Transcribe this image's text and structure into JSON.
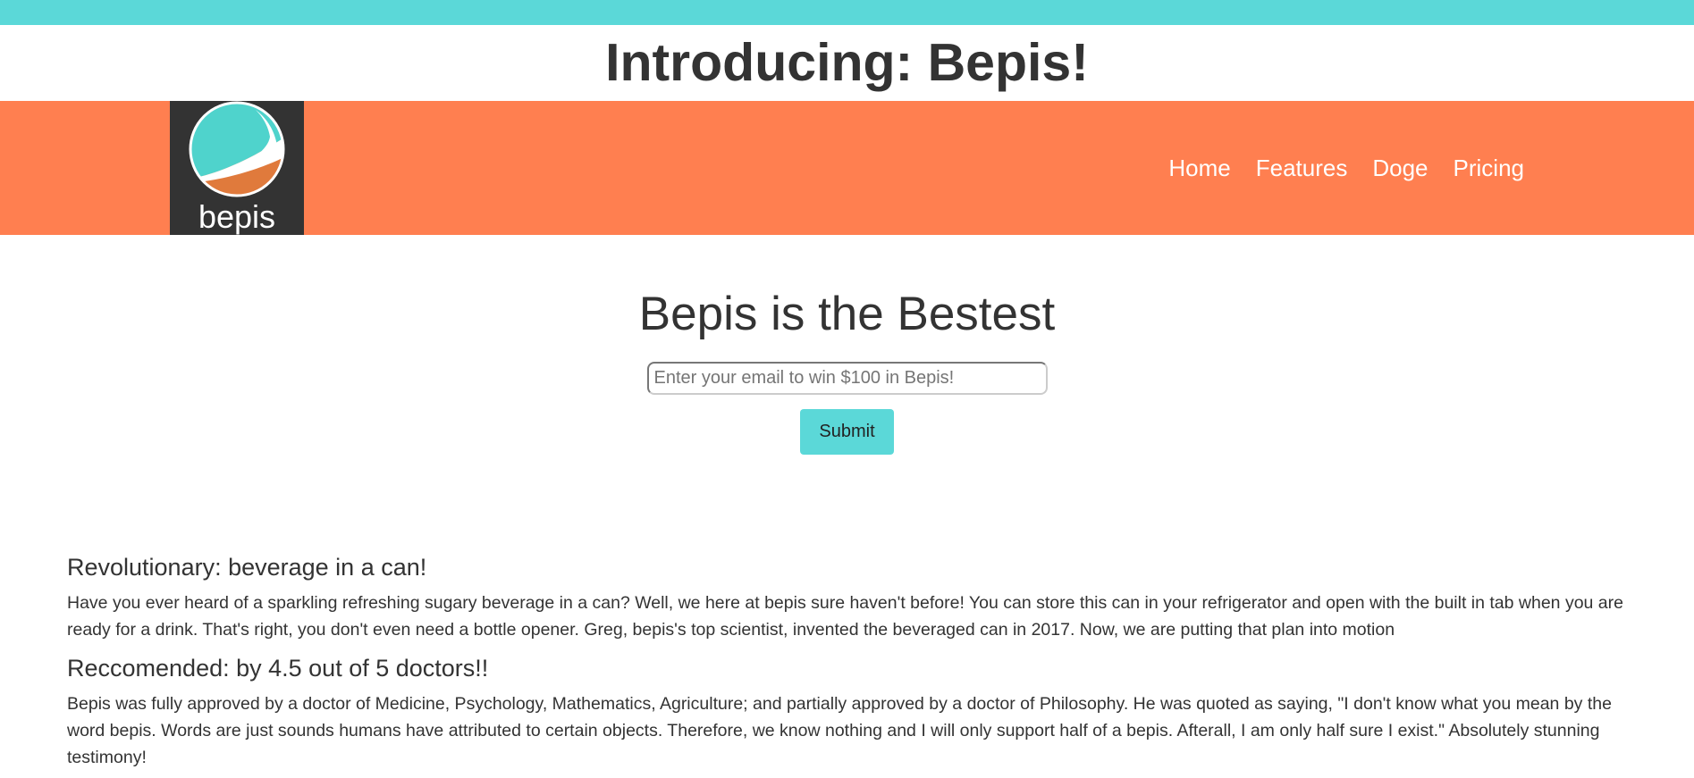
{
  "page": {
    "title": "Introducing: Bepis!"
  },
  "colors": {
    "top_strip": "#5bd8d8",
    "navbar": "#ff7f50",
    "logo_bg": "#333333",
    "button": "#5bd8d8"
  },
  "logo": {
    "text": "bepis",
    "icon": "bepis-logo-icon"
  },
  "nav": {
    "items": [
      {
        "label": "Home"
      },
      {
        "label": "Features"
      },
      {
        "label": "Doge"
      },
      {
        "label": "Pricing"
      }
    ]
  },
  "hero": {
    "title": "Bepis is the Bestest",
    "email_placeholder": "Enter your email to win $100 in Bepis!",
    "submit_label": "Submit"
  },
  "features": [
    {
      "heading": "Revolutionary: beverage in a can!",
      "text": "Have you ever heard of a sparkling refreshing sugary beverage in a can? Well, we here at bepis sure haven't before! You can store this can in your refrigerator and open with the built in tab when you are ready for a drink. That's right, you don't even need a bottle opener. Greg, bepis's top scientist, invented the beveraged can in 2017. Now, we are putting that plan into motion"
    },
    {
      "heading": "Reccomended: by 4.5 out of 5 doctors!!",
      "text": "Bepis was fully approved by a doctor of Medicine, Psychology, Mathematics, Agriculture; and partially approved by a doctor of Philosophy. He was quoted as saying, \"I don't know what you mean by the word bepis. Words are just sounds humans have attributed to certain objects. Therefore, we know nothing and I will only support half of a bepis. Afterall, I am only half sure I exist.\" Absolutely stunning testimony!"
    }
  ]
}
